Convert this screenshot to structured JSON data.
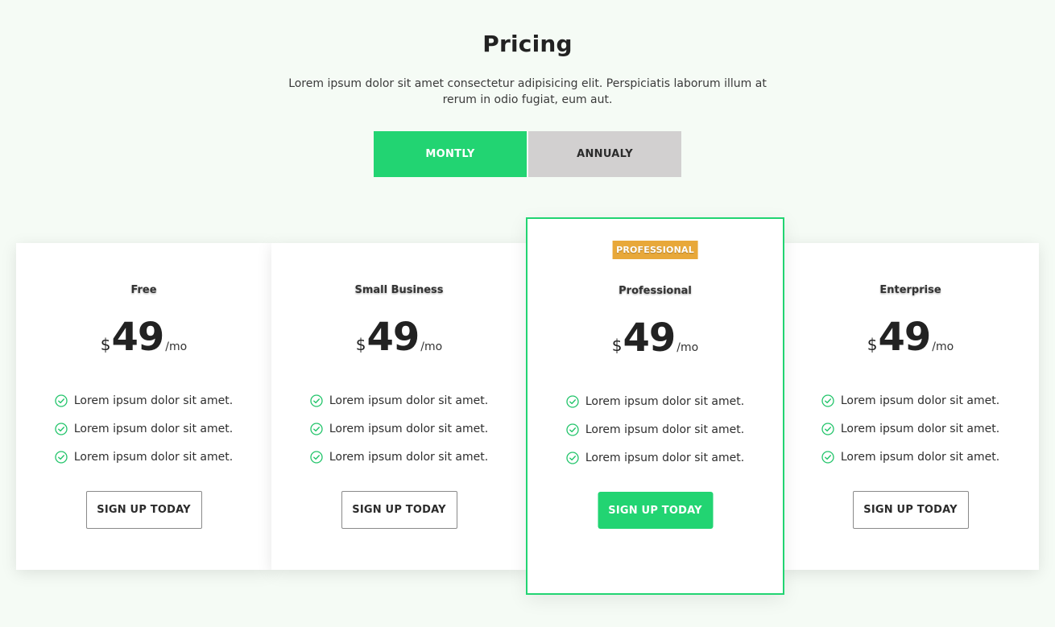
{
  "header": {
    "title": "Pricing",
    "subtitle": "Lorem ipsum dolor sit amet consectetur adipisicing elit. Perspiciatis laborum illum at rerum in odio fugiat, eum aut."
  },
  "billing_toggle": {
    "monthly_label": "MONTLY",
    "annual_label": "ANNUALY",
    "selected": "monthly"
  },
  "colors": {
    "accent": "#22d472",
    "badge": "#e8a83a",
    "inactive_toggle": "#d2d0d0",
    "background": "#f5fbf5"
  },
  "plans": [
    {
      "name": "Free",
      "currency": "$",
      "amount": "49",
      "period": "/mo",
      "features": [
        "Lorem ipsum dolor sit amet.",
        "Lorem ipsum dolor sit amet.",
        "Lorem ipsum dolor sit amet."
      ],
      "cta": "SIGN UP TODAY"
    },
    {
      "name": "Small Business",
      "currency": "$",
      "amount": "49",
      "period": "/mo",
      "features": [
        "Lorem ipsum dolor sit amet.",
        "Lorem ipsum dolor sit amet.",
        "Lorem ipsum dolor sit amet."
      ],
      "cta": "SIGN UP TODAY"
    },
    {
      "name": "Professional",
      "badge": "PROFESSIONAL",
      "featured": true,
      "currency": "$",
      "amount": "49",
      "period": "/mo",
      "features": [
        "Lorem ipsum dolor sit amet.",
        "Lorem ipsum dolor sit amet.",
        "Lorem ipsum dolor sit amet."
      ],
      "cta": "SIGN UP TODAY"
    },
    {
      "name": "Enterprise",
      "currency": "$",
      "amount": "49",
      "period": "/mo",
      "features": [
        "Lorem ipsum dolor sit amet.",
        "Lorem ipsum dolor sit amet.",
        "Lorem ipsum dolor sit amet."
      ],
      "cta": "SIGN UP TODAY"
    }
  ],
  "icons": {
    "feature_icon": "check-circle-icon"
  }
}
